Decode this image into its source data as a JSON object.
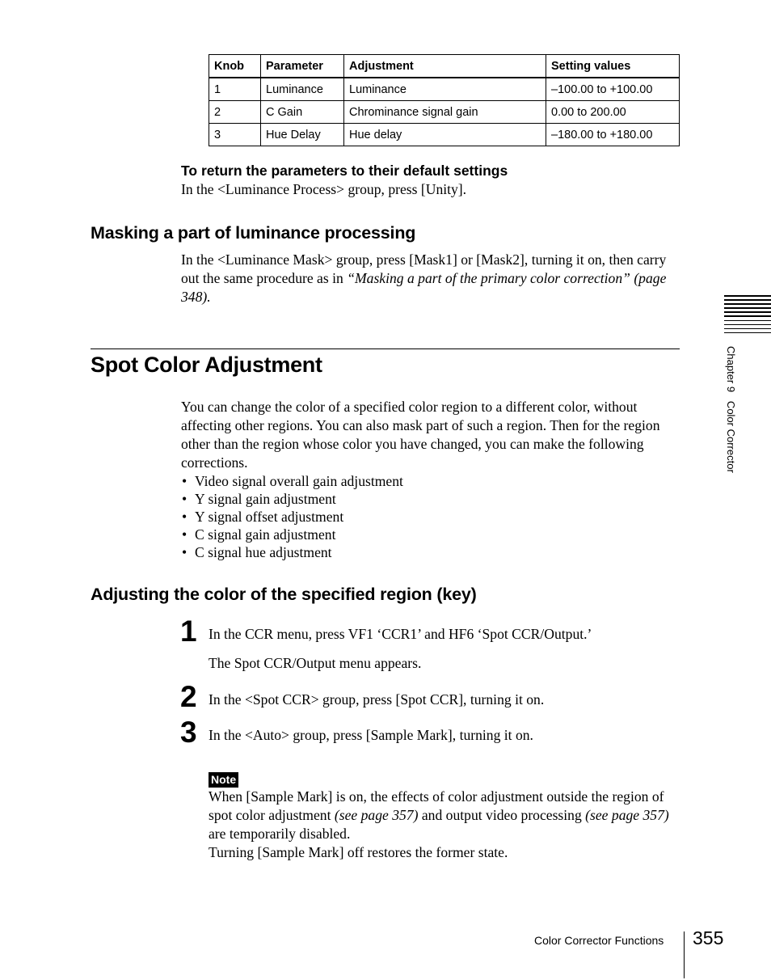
{
  "table": {
    "headers": [
      "Knob",
      "Parameter",
      "Adjustment",
      "Setting values"
    ],
    "rows": [
      [
        "1",
        "Luminance",
        "Luminance",
        "–100.00 to +100.00"
      ],
      [
        "2",
        "C Gain",
        "Chrominance signal gain",
        "0.00 to 200.00"
      ],
      [
        "3",
        "Hue Delay",
        "Hue delay",
        "–180.00 to +180.00"
      ]
    ]
  },
  "defaults": {
    "heading": "To return the parameters to their default settings",
    "text": "In the <Luminance Process> group, press [Unity]."
  },
  "masking": {
    "heading": "Masking a part of luminance processing",
    "text_before": "In the <Luminance Mask> group, press [Mask1] or [Mask2], turning it on, then carry out the same procedure as in ",
    "text_italic": "“Masking a part of the primary color correction” (page 348)."
  },
  "spot": {
    "title": "Spot Color Adjustment",
    "intro": "You can change the color of a specified color region to a different color, without affecting other regions. You can also mask part of such a region. Then for the region other than the region whose color you have changed, you can make the following corrections.",
    "bullet_glyph": "•",
    "bullets": [
      "Video signal overall gain adjustment",
      "Y signal gain adjustment",
      "Y signal offset adjustment",
      "C signal gain adjustment",
      "C signal hue adjustment"
    ]
  },
  "key_section": {
    "heading": "Adjusting the color of the specified region (key)",
    "steps": [
      {
        "number": "1",
        "text": "In the CCR menu, press VF1 ‘CCR1’ and HF6 ‘Spot CCR/Output.’",
        "result": "The Spot CCR/Output menu appears."
      },
      {
        "number": "2",
        "text": "In the <Spot CCR> group, press [Spot CCR], turning it on."
      },
      {
        "number": "3",
        "text": "In the <Auto> group, press [Sample Mark], turning it on."
      }
    ],
    "note": {
      "label": "Note",
      "p1_a": "When [Sample Mark] is on, the effects of color adjustment outside the region of spot color adjustment ",
      "p1_i1": "(see page 357)",
      "p1_b": " and output video processing ",
      "p1_i2": "(see page 357)",
      "p1_c": " are temporarily disabled.",
      "p2": "Turning [Sample Mark] off restores the former state."
    }
  },
  "sidebar": {
    "chapter_label": "Chapter 9   Color Corrector"
  },
  "footer": {
    "section": "Color Corrector Functions",
    "page_number": "355"
  }
}
